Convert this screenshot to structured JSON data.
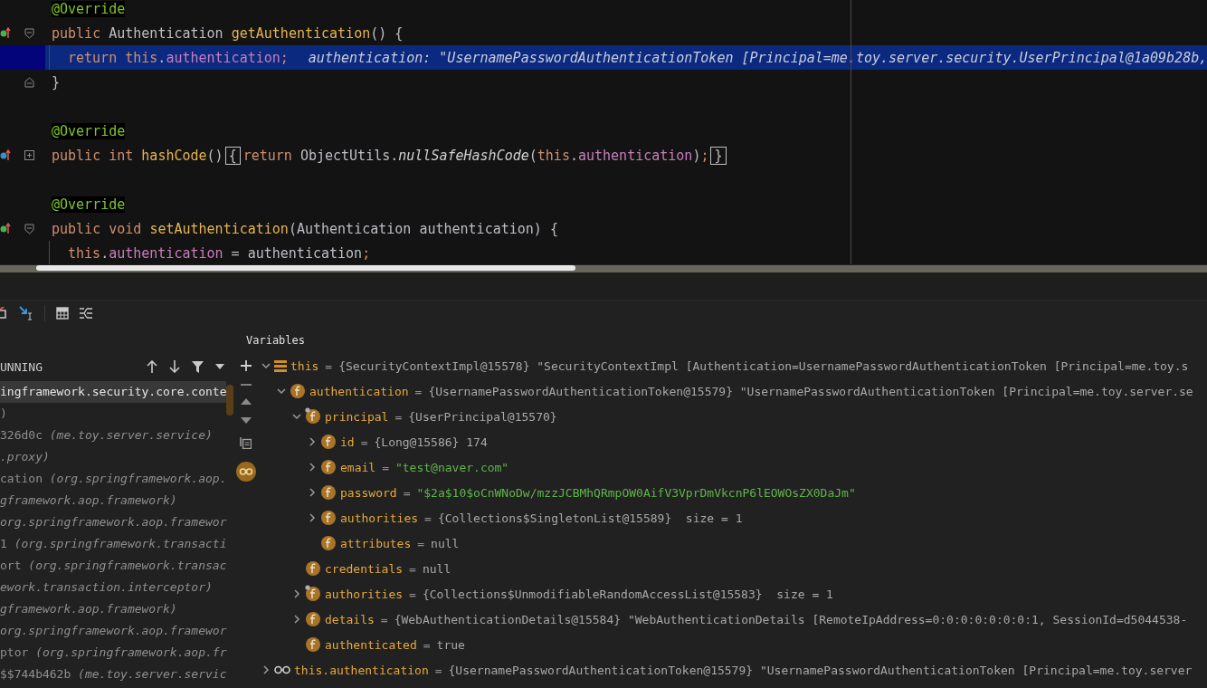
{
  "editor": {
    "lines": [
      {
        "current": false,
        "indented": false,
        "tokens": [
          {
            "text": "@Override",
            "kind": "annotation"
          }
        ]
      },
      {
        "gutter": {
          "kind": "implements"
        },
        "fold": {
          "kind": "start"
        },
        "current": false,
        "indented": false,
        "tokens": [
          {
            "text": "public ",
            "kind": "keyword"
          },
          {
            "text": "Authentication ",
            "kind": "plain"
          },
          {
            "text": "getAuthentication",
            "kind": "method"
          },
          {
            "text": "() {",
            "kind": "plain"
          }
        ]
      },
      {
        "current": true,
        "indented": true,
        "tokens": [
          {
            "text": "return ",
            "kind": "keyword"
          },
          {
            "text": "this",
            "kind": "keyword"
          },
          {
            "text": ".",
            "kind": "plain"
          },
          {
            "text": "authentication",
            "kind": "field"
          },
          {
            "text": ";",
            "kind": "semicolon"
          }
        ],
        "hint": "authentication: \"UsernamePasswordAuthenticationToken [Principal=me.toy.server.security.UserPrincipal@1a09b28b,"
      },
      {
        "fold": {
          "kind": "end"
        },
        "current": false,
        "indented": false,
        "tokens": [
          {
            "text": "}",
            "kind": "plain"
          }
        ]
      },
      {
        "current": false,
        "indented": false
      },
      {
        "current": false,
        "indented": false,
        "tokens": [
          {
            "text": "@Override",
            "kind": "annotation"
          }
        ]
      },
      {
        "gutter": {
          "kind": "overrides"
        },
        "fold": {
          "kind": "collapsed"
        },
        "current": false,
        "indented": false,
        "tokens": [
          {
            "text": "public ",
            "kind": "keyword"
          },
          {
            "text": "int ",
            "kind": "keyword"
          },
          {
            "text": "hashCode",
            "kind": "method"
          },
          {
            "text": "()",
            "kind": "plain"
          },
          {
            "text": "{",
            "kind": "brace"
          },
          {
            "text": "return ",
            "kind": "keyword"
          },
          {
            "text": "ObjectUtils.",
            "kind": "plain"
          },
          {
            "text": "nullSafeHashCode",
            "kind": "static"
          },
          {
            "text": "(",
            "kind": "plain"
          },
          {
            "text": "this",
            "kind": "keyword"
          },
          {
            "text": ".",
            "kind": "plain"
          },
          {
            "text": "authentication",
            "kind": "field"
          },
          {
            "text": ")",
            "kind": "plain"
          },
          {
            "text": ";",
            "kind": "semicolon"
          },
          {
            "text": "}",
            "kind": "brace"
          }
        ]
      },
      {
        "current": false,
        "indented": false
      },
      {
        "current": false,
        "indented": false,
        "tokens": [
          {
            "text": "@Override",
            "kind": "annotation"
          }
        ]
      },
      {
        "gutter": {
          "kind": "implements"
        },
        "fold": {
          "kind": "start"
        },
        "current": false,
        "indented": false,
        "tokens": [
          {
            "text": "public ",
            "kind": "keyword"
          },
          {
            "text": "void ",
            "kind": "keyword"
          },
          {
            "text": "setAuthentication",
            "kind": "method"
          },
          {
            "text": "(Authentication authentication) {",
            "kind": "plain"
          }
        ]
      },
      {
        "current": false,
        "indented": true,
        "tokens": [
          {
            "text": "this",
            "kind": "keyword"
          },
          {
            "text": ".",
            "kind": "plain"
          },
          {
            "text": "authentication",
            "kind": "field"
          },
          {
            "text": " = authentication",
            "kind": "plain"
          },
          {
            "text": ";",
            "kind": "semicolon"
          }
        ]
      }
    ]
  },
  "frames": {
    "header": "UNNING",
    "items": [
      {
        "name": "ingframework.security.core.conte",
        "selected": true
      },
      {
        "name": ")",
        "selected": false
      },
      {
        "name": "326d0c ",
        "package": "(me.toy.server.service)",
        "selected": false
      },
      {
        "package": ".proxy)",
        "selected": false
      },
      {
        "name": "cation ",
        "package": "(org.springframework.aop.",
        "selected": false
      },
      {
        "package": "gframework.aop.framework)",
        "selected": false
      },
      {
        "package": "org.springframework.aop.framewor",
        "selected": false
      },
      {
        "name": "1 ",
        "package": "(org.springframework.transacti",
        "selected": false
      },
      {
        "name": "ort ",
        "package": "(org.springframework.transac",
        "selected": false
      },
      {
        "package": "ework.transaction.interceptor)",
        "selected": false
      },
      {
        "package": "gframework.aop.framework)",
        "selected": false
      },
      {
        "package": "org.springframework.aop.framewor",
        "selected": false
      },
      {
        "name": "ptor ",
        "package": "(org.springframework.aop.fr",
        "selected": false
      },
      {
        "name": "$$744b462b ",
        "package": "(me.toy.server.servic",
        "selected": false
      }
    ]
  },
  "variables": {
    "title": "Variables",
    "nodes": [
      {
        "name": "this",
        "kind": "object",
        "op": "=",
        "value": "{SecurityContextImpl@15578} \"SecurityContextImpl [Authentication=UsernamePasswordAuthenticationToken [Principal=me.toy.s",
        "is_string": false,
        "expandable": true,
        "expanded": true,
        "marked": false,
        "children": [
          {
            "name": "authentication",
            "kind": "field",
            "op": "=",
            "value": "{UsernamePasswordAuthenticationToken@15579} \"UsernamePasswordAuthenticationToken [Principal=me.toy.server.se",
            "is_string": false,
            "expandable": true,
            "expanded": true,
            "marked": false,
            "children": [
              {
                "name": "principal",
                "kind": "field",
                "op": "=",
                "value": "{UserPrincipal@15570}",
                "is_string": false,
                "expandable": true,
                "expanded": true,
                "marked": true,
                "children": [
                  {
                    "name": "id",
                    "kind": "field",
                    "op": "=",
                    "value": "{Long@15586} 174",
                    "is_string": false,
                    "expandable": true,
                    "expanded": false,
                    "marked": false
                  },
                  {
                    "name": "email",
                    "kind": "field",
                    "op": "=",
                    "value": "\"test@naver.com\"",
                    "is_string": true,
                    "expandable": true,
                    "expanded": false,
                    "marked": false
                  },
                  {
                    "name": "password",
                    "kind": "field",
                    "op": "=",
                    "value": "\"$2a$10$oCnWNoDw/mzzJCBMhQRmpOW0AifV3VprDmVkcnP6lEOWOsZX0DaJm\"",
                    "is_string": true,
                    "expandable": true,
                    "expanded": false,
                    "marked": false
                  },
                  {
                    "name": "authorities",
                    "kind": "field",
                    "op": "=",
                    "value": "{Collections$SingletonList@15589}  size = 1",
                    "is_string": false,
                    "expandable": true,
                    "expanded": false,
                    "marked": false
                  },
                  {
                    "name": "attributes",
                    "kind": "field",
                    "op": "=",
                    "value": "null",
                    "is_string": false,
                    "expandable": false,
                    "expanded": false,
                    "marked": false
                  }
                ]
              },
              {
                "name": "credentials",
                "kind": "field",
                "op": "=",
                "value": "null",
                "is_string": false,
                "expandable": false,
                "expanded": false,
                "marked": false
              },
              {
                "name": "authorities",
                "kind": "field",
                "op": "=",
                "value": "{Collections$UnmodifiableRandomAccessList@15583}  size = 1",
                "is_string": false,
                "expandable": true,
                "expanded": false,
                "marked": true
              },
              {
                "name": "details",
                "kind": "field",
                "op": "=",
                "value": "{WebAuthenticationDetails@15584} \"WebAuthenticationDetails [RemoteIpAddress=0:0:0:0:0:0:0:1, SessionId=d5044538-",
                "is_string": false,
                "expandable": true,
                "expanded": false,
                "marked": false
              },
              {
                "name": "authenticated",
                "kind": "field",
                "op": "=",
                "value": "true",
                "is_string": false,
                "expandable": false,
                "expanded": false,
                "marked": false
              }
            ]
          }
        ]
      },
      {
        "name": "this.authentication",
        "kind": "watch",
        "op": "=",
        "value": "{UsernamePasswordAuthenticationToken@15579} \"UsernamePasswordAuthenticationToken [Principal=me.toy.server",
        "is_string": false,
        "expandable": true,
        "expanded": false,
        "marked": false
      }
    ]
  }
}
